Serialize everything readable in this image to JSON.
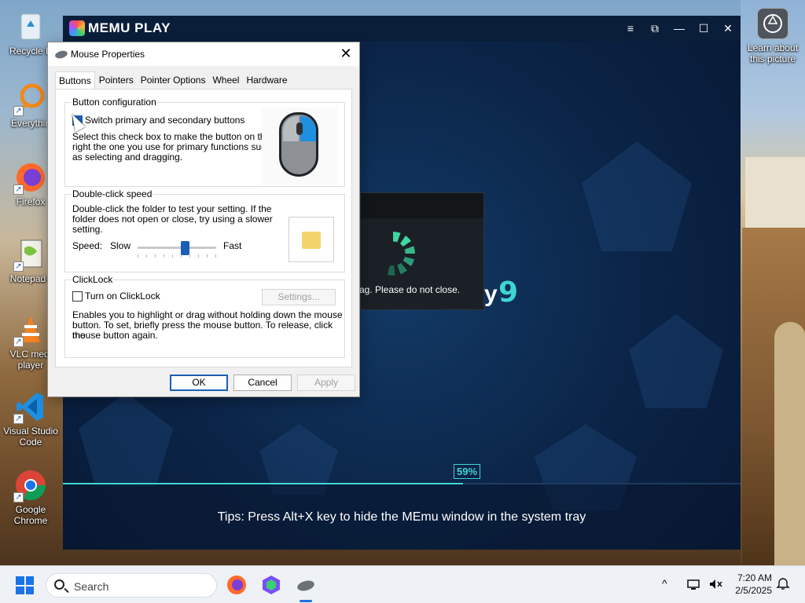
{
  "desktop": {
    "icons": [
      {
        "label": "Recycle Bin",
        "short_label": "Recycle B",
        "icon": "recycle-bin-icon"
      },
      {
        "label": "Everything",
        "short_label": "Everythin",
        "icon": "everything-search-icon"
      },
      {
        "label": "Firefox",
        "icon": "firefox-icon"
      },
      {
        "label": "Notepad++",
        "short_label": "Notepad+",
        "icon": "notepad-plus-plus-icon"
      },
      {
        "label": "VLC media player",
        "line1": "VLC medi",
        "line2": "player",
        "icon": "vlc-icon"
      },
      {
        "label": "Visual Studio Code",
        "line1": "Visual Studio",
        "line2": "Code",
        "icon": "vscode-icon"
      },
      {
        "label": "Google Chrome",
        "line1": "Google",
        "line2": "Chrome",
        "icon": "chrome-icon"
      }
    ],
    "learn_about": {
      "line1": "Learn about",
      "line2": "this picture",
      "icon": "camera-icon"
    }
  },
  "memu": {
    "title": "MEMU PLAY",
    "logo_text": "MEMU PL",
    "logo_end": "Y",
    "controls": {
      "menu": "≡",
      "restore": "⧉",
      "minimize": "—",
      "maximize": "☐",
      "close": "✕"
    },
    "loading_message": "ag. Please do not close.",
    "brand_digit": "9",
    "brand_letter": "y",
    "progress_percent": 59,
    "progress_label": "59%",
    "tips": "Tips: Press Alt+X key to hide the MEmu window in the system tray",
    "colors": {
      "accent": "#3fd6d2",
      "background": "#0b2447"
    }
  },
  "dialog": {
    "title": "Mouse Properties",
    "close": "✕",
    "tabs": [
      {
        "label": "Buttons",
        "active": true
      },
      {
        "label": "Pointers",
        "active": false
      },
      {
        "label": "Pointer Options",
        "active": false
      },
      {
        "label": "Wheel",
        "active": false
      },
      {
        "label": "Hardware",
        "active": false
      }
    ],
    "button_config": {
      "label": "Button configuration",
      "checkbox_label": "Switch primary and secondary buttons",
      "checked": true,
      "desc1": "Select this check box to make the button on the",
      "desc2": "right the one you use for primary functions such",
      "desc3": "as selecting and dragging."
    },
    "double_click": {
      "label": "Double-click speed",
      "desc1": "Double-click the folder to test your setting. If the",
      "desc2": "folder does not open or close, try using a slower",
      "desc3": "setting.",
      "speed_label": "Speed:",
      "slow": "Slow",
      "fast": "Fast",
      "slider_value": 0.6
    },
    "clicklock": {
      "label": "ClickLock",
      "checkbox_label": "Turn on ClickLock",
      "checked": false,
      "settings_button": "Settings...",
      "desc1": "Enables you to highlight or drag without holding down the mouse",
      "desc2": "button. To set, briefly press the mouse button. To release, click the",
      "desc3": "mouse button again."
    },
    "buttons": {
      "ok": "OK",
      "cancel": "Cancel",
      "apply": "Apply"
    }
  },
  "taskbar": {
    "search_placeholder": "Search",
    "apps": [
      "firefox-icon",
      "memu-icon",
      "mouse-properties-icon"
    ],
    "time": "7:20 AM",
    "date": "2/5/2025",
    "tray_chevron": "^",
    "colors": {
      "accent": "#1a73e8"
    }
  }
}
